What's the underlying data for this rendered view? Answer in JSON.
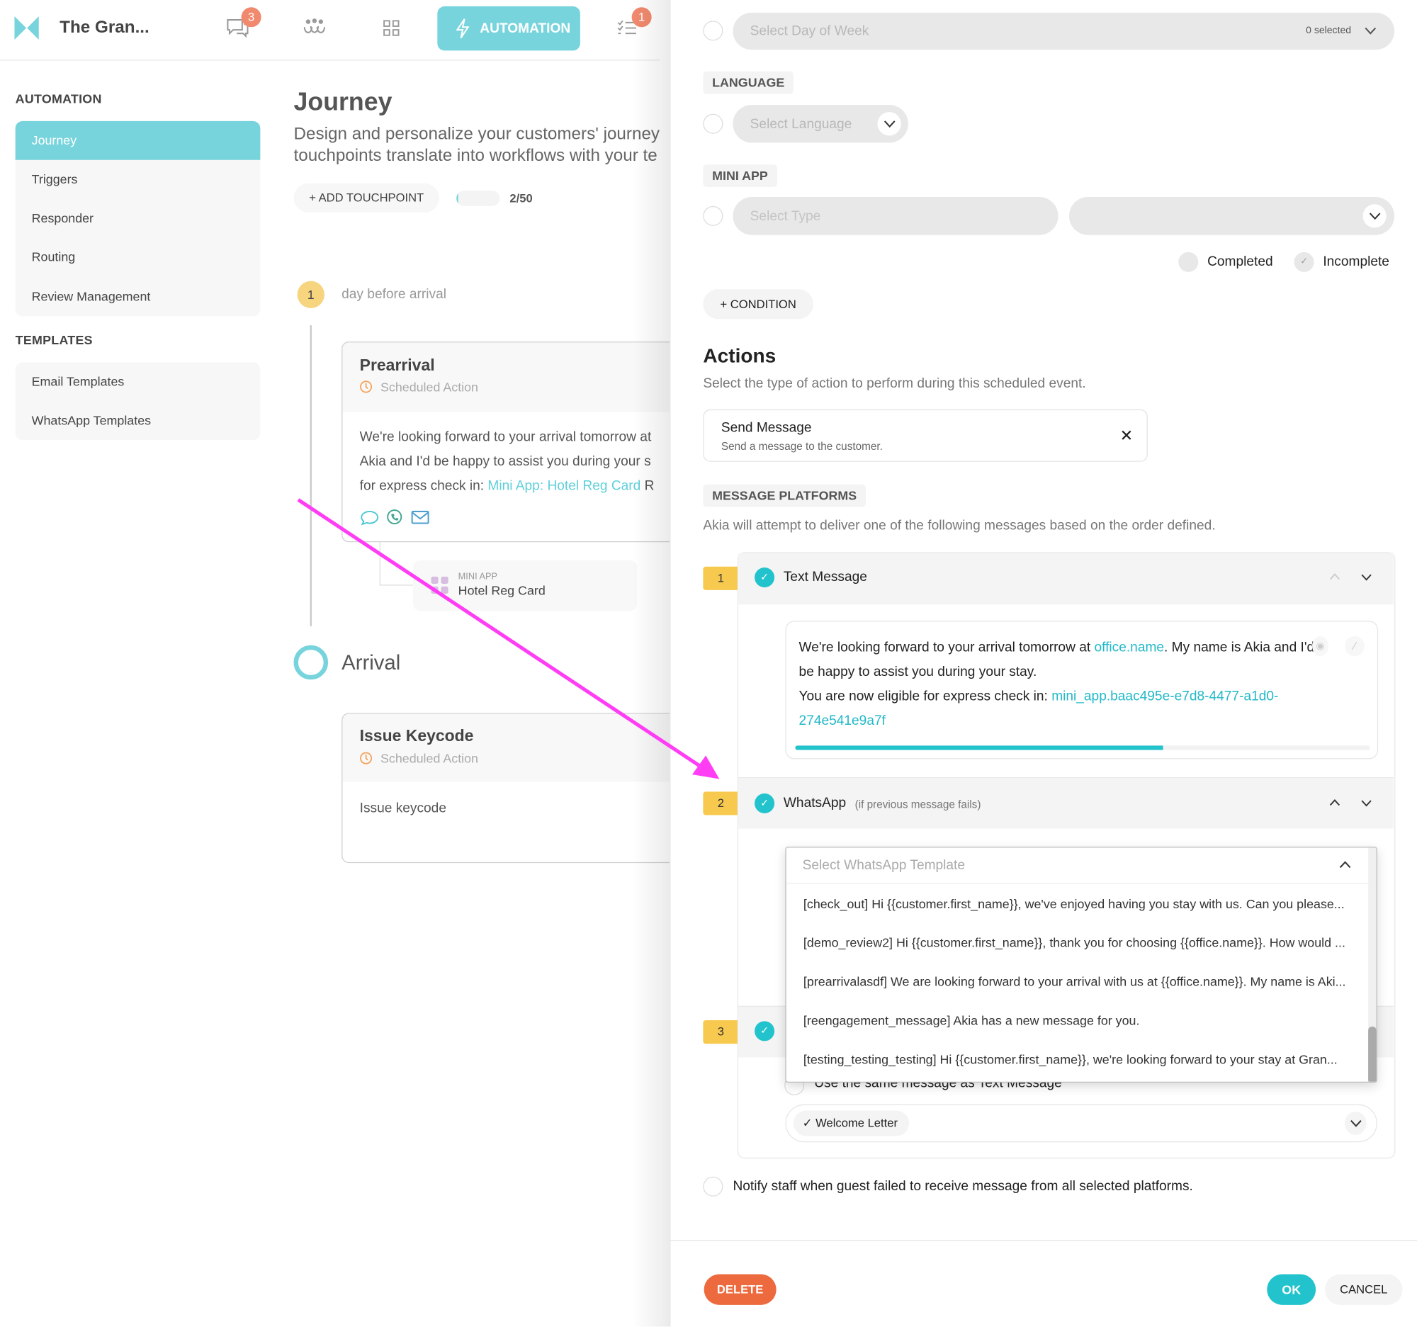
{
  "topbar": {
    "title": "The Gran...",
    "chat_badge": "3",
    "tasks_badge": "1",
    "automation_label": "AUTOMATION",
    "icons": [
      "logo",
      "chat-icon",
      "people-icon",
      "grid-icon",
      "lightning-icon",
      "checklist-icon"
    ]
  },
  "sidebar": {
    "automation_heading": "AUTOMATION",
    "automation_items": [
      {
        "label": "Journey",
        "active": true
      },
      {
        "label": "Triggers"
      },
      {
        "label": "Responder"
      },
      {
        "label": "Routing"
      },
      {
        "label": "Review Management"
      }
    ],
    "templates_heading": "TEMPLATES",
    "template_items": [
      {
        "label": "Email Templates"
      },
      {
        "label": "WhatsApp Templates"
      }
    ]
  },
  "main": {
    "title": "Journey",
    "description_line1": "Design and personalize your customers' journey",
    "description_line2": "touchpoints translate into workflows with your te",
    "add_touchpoint": "+ ADD TOUCHPOINT",
    "touchpoint_count": "2/50",
    "touchpoint_progress": 0.04,
    "step1": {
      "number": "1",
      "label": "day before arrival"
    },
    "prearrival": {
      "title": "Prearrival",
      "subtitle": "Scheduled Action",
      "line1": "We're looking forward to your arrival tomorrow at",
      "line2": "Akia and I'd be happy to assist you during your s",
      "line3_prefix": "for express check in: ",
      "line3_link": "Mini App: Hotel Reg Card",
      "line3_suffix": " R"
    },
    "mini_app": {
      "label": "MINI APP",
      "name": "Hotel Reg Card"
    },
    "arrival": {
      "label": "Arrival"
    },
    "issue_keycode": {
      "title": "Issue Keycode",
      "subtitle": "Scheduled Action",
      "body": "Issue keycode"
    }
  },
  "panel": {
    "day_of_week": {
      "placeholder": "Select Day of Week",
      "count": "0 selected"
    },
    "language": {
      "tag": "LANGUAGE",
      "placeholder": "Select Language"
    },
    "mini_app": {
      "tag": "MINI APP",
      "type_placeholder": "Select Type"
    },
    "status": {
      "completed": "Completed",
      "incomplete": "Incomplete"
    },
    "add_condition": "+ CONDITION",
    "actions": {
      "title": "Actions",
      "subtitle": "Select the type of action to perform during this scheduled event."
    },
    "send_message": {
      "title": "Send Message",
      "subtitle": "Send a message to the customer."
    },
    "platforms": {
      "tag": "MESSAGE PLATFORMS",
      "description": "Akia will attempt to deliver one of the following messages based on the order defined.",
      "items": [
        {
          "number": "1",
          "name": "Text Message"
        },
        {
          "number": "2",
          "name": "WhatsApp",
          "note": "(if previous message fails)"
        },
        {
          "number": "3"
        }
      ]
    },
    "text_message": {
      "l1_a": "We're looking forward to your arrival tomorrow at ",
      "l1_link": "office.name",
      "l1_b": ". My name is Akia and I'd",
      "l2": "be happy to assist you during your stay.",
      "l3_a": "You are now eligible for express check in: ",
      "l3_link": "mini_app.baac495e-e7d8-4477-a1d0-",
      "l4_link": "274e541e9a7f",
      "length_progress": 0.64
    },
    "whatsapp_dropdown": {
      "placeholder": "Select WhatsApp Template",
      "options": [
        "[check_out] Hi {{customer.first_name}}, we've enjoyed having you stay with us. Can you please...",
        "[demo_review2] Hi {{customer.first_name}}, thank you for choosing {{office.name}}. How would ...",
        "[prearrivalasdf] We are looking forward to your arrival with us at {{office.name}}. My name is Aki...",
        "[reengagement_message] Akia has a new message for you.",
        "[testing_testing_testing] Hi {{customer.first_name}}, we're looking forward to your stay at Gran..."
      ]
    },
    "email": {
      "same_message": "Use the same message as Text Message",
      "selected_template": "✓ Welcome Letter"
    },
    "notify_staff": "Notify staff when guest failed to receive message from all selected platforms.",
    "footer": {
      "delete": "DELETE",
      "ok": "OK",
      "cancel": "CANCEL"
    }
  },
  "colors": {
    "accent": "#77d4dc",
    "teal": "#22c3cc",
    "badge": "#f0896e",
    "step": "#f7c94f",
    "delete": "#ec6a3d",
    "annotation_arrow": "#ff3df5"
  }
}
